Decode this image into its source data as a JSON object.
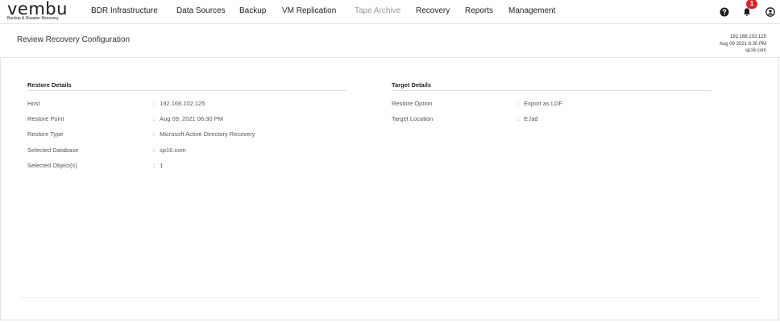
{
  "app": {
    "logo_text": "vembu",
    "logo_tagline": "Backup & Disaster Recovery"
  },
  "nav": {
    "items": [
      {
        "label": "BDR Infrastructure",
        "dim": false
      },
      {
        "label": "Data Sources",
        "dim": false
      },
      {
        "label": "Backup",
        "dim": false
      },
      {
        "label": "VM Replication",
        "dim": false
      },
      {
        "label": "Tape Archive",
        "dim": true
      },
      {
        "label": "Recovery",
        "dim": false
      },
      {
        "label": "Reports",
        "dim": false
      },
      {
        "label": "Management",
        "dim": false
      }
    ]
  },
  "toolbar": {
    "help_icon": "help-icon",
    "notifications_icon": "bell-icon",
    "notification_count": "1",
    "user_icon": "user-icon"
  },
  "header": {
    "title": "Review Recovery Configuration",
    "server_ip": "192.168.102.125",
    "server_time": "Aug 09 2021 6:30 PM",
    "server_name": "sp16.com"
  },
  "restore_details": {
    "title": "Restore Details",
    "rows": [
      {
        "label": "Host",
        "value": "192.168.102.125"
      },
      {
        "label": "Restore Point",
        "value": "Aug 09, 2021 06:30 PM"
      },
      {
        "label": "Restore Type",
        "value": "Microsoft Active Directory Recovery"
      },
      {
        "label": "Selected Database",
        "value": "sp16.com"
      },
      {
        "label": "Selected Object(s)",
        "value": "1"
      }
    ]
  },
  "target_details": {
    "title": "Target Details",
    "rows": [
      {
        "label": "Restore Option",
        "value": "Export as LDF"
      },
      {
        "label": "Target Location",
        "value": "E:/ad"
      }
    ]
  },
  "colors": {
    "accent": "#d9252a",
    "text": "#333333",
    "dim_text": "#999999"
  }
}
